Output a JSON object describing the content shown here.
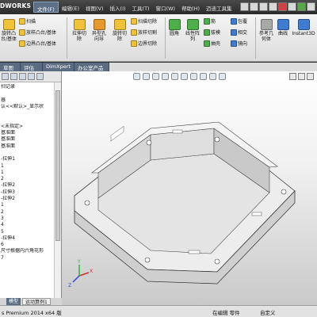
{
  "app": {
    "logo_text": "DWORKS",
    "menu": [
      "文件(F)",
      "编辑(E)",
      "视图(V)",
      "插入(I)",
      "工具(T)",
      "窗口(W)",
      "帮助(H)",
      "迈迪工具集"
    ]
  },
  "ribbon": {
    "revolve_boss_lines": [
      "旋转凸",
      "台/基体"
    ],
    "sweep_label": "扫描",
    "loft_boss_label": "放样凸台/基体",
    "boundary_boss_label": "边界凸台/基体",
    "extruded_cut_lines": [
      "拉伸切",
      "除"
    ],
    "hole_wizard_lines": [
      "异型孔",
      "向导"
    ],
    "revolved_cut_lines": [
      "旋转切",
      "除"
    ],
    "swept_cut_label": "扫描切除",
    "lofted_cut_label": "放样切割",
    "boundary_cut_label": "边界切除",
    "fillet_label": "圆角",
    "linear_pattern_lines": [
      "线性阵",
      "列"
    ],
    "rib_label": "筋",
    "draft_label": "拔模",
    "shell_label": "抽壳",
    "wrap_label": "包覆",
    "intersect_label": "相交",
    "mirror_label": "镜向",
    "ref_geometry_lines": [
      "参考几",
      "何体"
    ],
    "curves_label": "曲线",
    "instant3d_label": "Instant3D"
  },
  "tabs": [
    "草图",
    "评估",
    "DimXpert",
    "办公室产品"
  ],
  "tree": {
    "items": [
      "扫记录",
      "",
      "器",
      "认<<默认>_显示状",
      "",
      "",
      "<未指定>",
      "基准面",
      "基准面",
      "基准面",
      "",
      "-拉伸1",
      "1",
      "1",
      "2",
      "-拉伸2",
      "-拉伸3",
      "-拉伸2",
      "1",
      "2",
      "3",
      "4",
      "5",
      "-拉伸4",
      "6",
      "尺寸根据内六角花形",
      "7"
    ]
  },
  "bottom_tabs": [
    "模型",
    "运动算例1"
  ],
  "status": {
    "product": "s Premium 2014 x64 版",
    "mode": "在编辑 零件",
    "units": "自定义"
  },
  "triad": {
    "x_label": "X",
    "y_label": "Y",
    "z_label": "Z"
  },
  "colors": {
    "model_top": "#ececec",
    "model_wall": "#d2d2d2",
    "model_edge": "#3a3a3a",
    "triad_x": "#d42a2a",
    "triad_y": "#2bb34a",
    "triad_z": "#2a4ad4"
  }
}
